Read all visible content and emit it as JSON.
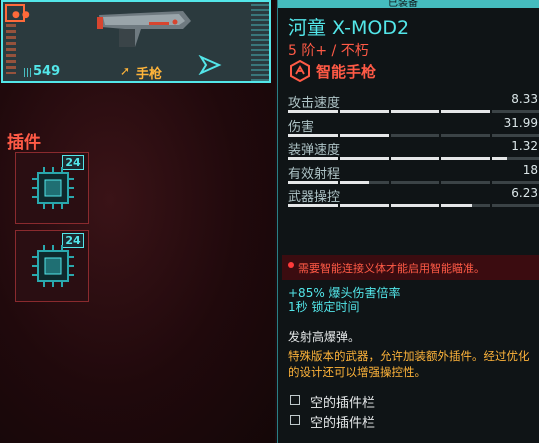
{
  "weapon_card": {
    "ammo": "549",
    "type": "手枪",
    "colors": {
      "accent": "#53e6e9",
      "orange": "#ff6a3a",
      "type": "#ffb43a"
    }
  },
  "mods": {
    "label": "插件",
    "slots": [
      {
        "level": "24"
      },
      {
        "level": "24"
      }
    ]
  },
  "panel": {
    "tab_label": "已装备",
    "name": "河童 X-MOD2",
    "tier": "5 阶+ / 不朽",
    "subtype": "智能手枪",
    "stats": [
      {
        "name": "攻击速度",
        "value": "8.33",
        "fill": 0.8
      },
      {
        "name": "伤害",
        "value": "31.99",
        "fill": 0.4
      },
      {
        "name": "装弹速度",
        "value": "1.32",
        "fill": 0.87
      },
      {
        "name": "有效射程",
        "value": "18",
        "fill": 0.32
      },
      {
        "name": "武器操控",
        "value": "6.23",
        "fill": 0.73
      }
    ],
    "warning": "需要智能连接义体才能启用智能瞄准。",
    "bonus_line1": "+85% 爆头伤害倍率",
    "bonus_line2": "1秒 锁定时间",
    "fire_mode": "发射高爆弹。",
    "description": "特殊版本的武器，允许加装额外插件。经过优化的设计还可以增强操控性。",
    "empty_slots": [
      "空的插件栏",
      "空的插件栏"
    ]
  }
}
